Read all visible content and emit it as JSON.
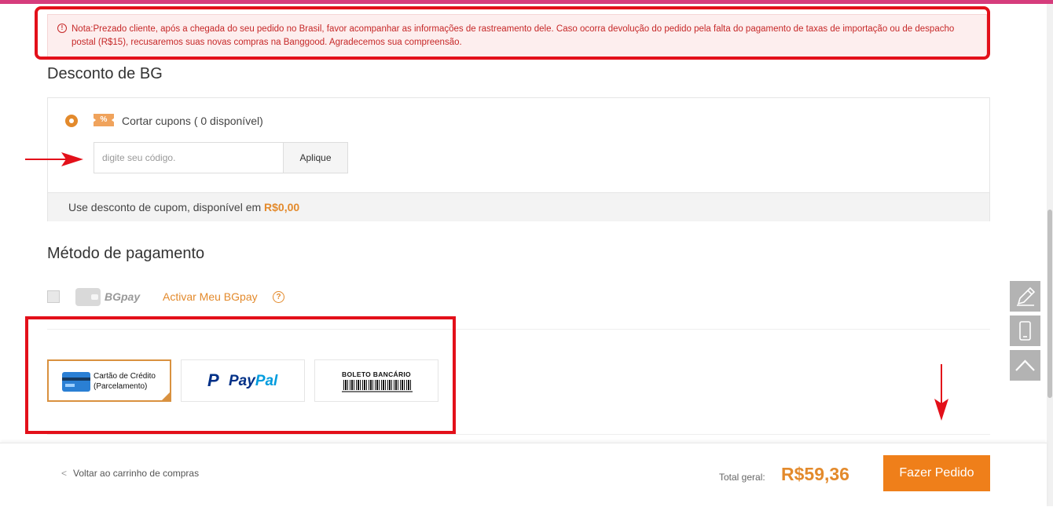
{
  "notice": {
    "icon": "info-circle-icon",
    "text": "Nota:Prezado cliente, após a chegada do seu pedido no Brasil, favor acompanhar as informações de rastreamento dele. Caso ocorra devolução do pedido pela falta do pagamento de taxas de importação ou de despacho postal (R$15), recusaremos suas novas compras na Banggood. Agradecemos sua compreensão."
  },
  "discount": {
    "title": "Desconto de BG",
    "coupon_label": "Cortar cupons ( 0 disponível)",
    "coupon_icon_text": "%",
    "input_placeholder": "digite seu código.",
    "input_value": "",
    "apply_label": "Aplique",
    "footer_text": "Use desconto de cupom, disponível em",
    "footer_amount": "R$0,00"
  },
  "payment": {
    "title": "Método de pagamento",
    "bgpay_label": "BGpay",
    "activate_link": "Activar Meu BGpay",
    "help_icon": "?",
    "methods": [
      {
        "name": "credit-card",
        "label_line1": "Cartão de Crédito",
        "label_line2": "(Parcelamento)",
        "selected": true
      },
      {
        "name": "paypal",
        "label_p": "P",
        "label_pay": "Pay",
        "label_pal": "Pal",
        "selected": false
      },
      {
        "name": "boleto",
        "label": "BOLETO BANCÁRIO",
        "selected": false
      }
    ]
  },
  "footer": {
    "back_chevron": "<",
    "back_label": "Voltar ao carrinho de compras",
    "total_label": "Total geral:",
    "total_amount": "R$59,36",
    "order_button": "Fazer Pedido"
  },
  "side_tools": [
    "pencil-icon",
    "mobile-icon",
    "chevron-up-icon"
  ],
  "colors": {
    "accent": "#e38a2c",
    "order_button": "#ef7f1a",
    "notice_text": "#c62828",
    "annotation": "#e3101a",
    "paypal_dark": "#003087",
    "paypal_light": "#009cde"
  }
}
